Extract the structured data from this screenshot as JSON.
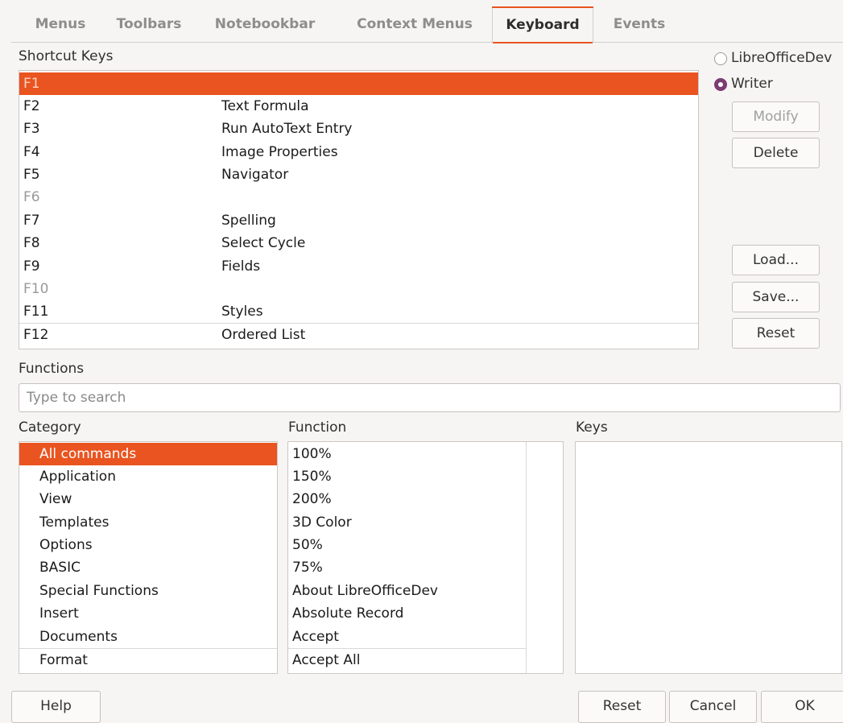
{
  "tabs": [
    "Menus",
    "Toolbars",
    "Notebookbar",
    "Context Menus",
    "Keyboard",
    "Events"
  ],
  "active_tab": "Keyboard",
  "shortcut_keys_label": "Shortcut Keys",
  "scope": {
    "options": [
      "LibreOfficeDev",
      "Writer"
    ],
    "selected": "Writer"
  },
  "shortcuts": [
    {
      "key": "F1",
      "command": ""
    },
    {
      "key": "F2",
      "command": "Text Formula"
    },
    {
      "key": "F3",
      "command": "Run AutoText Entry"
    },
    {
      "key": "F4",
      "command": "Image Properties"
    },
    {
      "key": "F5",
      "command": "Navigator"
    },
    {
      "key": "F6",
      "command": ""
    },
    {
      "key": "F7",
      "command": "Spelling"
    },
    {
      "key": "F8",
      "command": "Select Cycle"
    },
    {
      "key": "F9",
      "command": "Fields"
    },
    {
      "key": "F10",
      "command": ""
    },
    {
      "key": "F11",
      "command": "Styles"
    },
    {
      "key": "F12",
      "command": "Ordered List"
    }
  ],
  "side_buttons": {
    "modify": "Modify",
    "delete": "Delete",
    "load": "Load...",
    "save": "Save...",
    "reset": "Reset"
  },
  "functions_label": "Functions",
  "search_placeholder": "Type to search",
  "category_label": "Category",
  "function_label": "Function",
  "keys_label": "Keys",
  "categories": [
    "All commands",
    "Application",
    "View",
    "Templates",
    "Options",
    "BASIC",
    "Special Functions",
    "Insert",
    "Documents",
    "Format"
  ],
  "selected_category": "All commands",
  "functions": [
    "100%",
    "150%",
    "200%",
    "3D Color",
    "50%",
    "75%",
    "About LibreOfficeDev",
    "Absolute Record",
    "Accept",
    "Accept All"
  ],
  "bottom_buttons": {
    "help": "Help",
    "reset": "Reset",
    "cancel": "Cancel",
    "ok": "OK"
  }
}
